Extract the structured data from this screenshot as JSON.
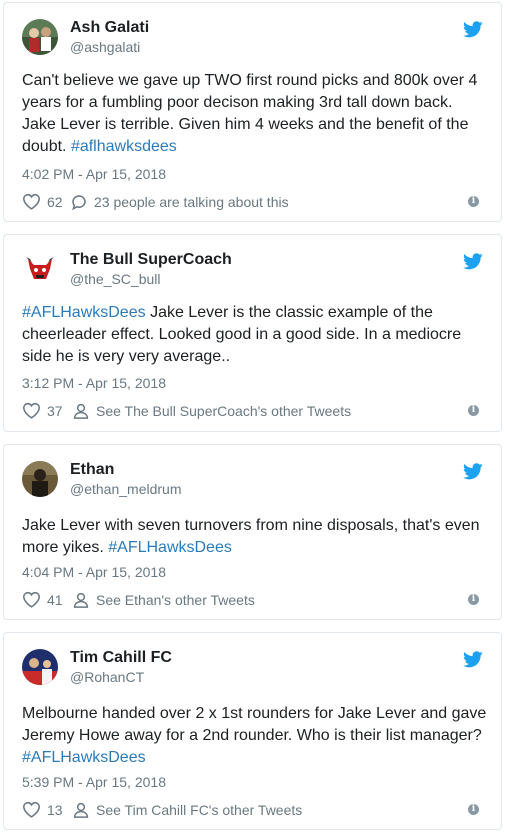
{
  "colors": {
    "link": "#2b7bb9",
    "muted": "#697882",
    "border": "#e1e8ed",
    "twitter_blue": "#1da1f2"
  },
  "tweets": [
    {
      "display_name": "Ash Galati",
      "handle": "@ashgalati",
      "text": "Can't believe we gave up TWO first round picks and 800k over 4 years for a fumbling poor decison making 3rd tall down back. Jake Lever is terrible. Given him 4 weeks and the benefit of the doubt.",
      "hashtag": "#aflhawksdees",
      "timestamp": "4:02 PM - Apr 15, 2018",
      "likes": "62",
      "extra_icon": "reply-bubble-icon",
      "extra_text": "23 people are talking about this"
    },
    {
      "display_name": "The Bull SuperCoach",
      "handle": "@the_SC_bull",
      "hashtag": "#AFLHawksDees",
      "text": "Jake Lever is the classic example of the cheerleader effect. Looked good in a good side. In a mediocre side he is very very average..",
      "timestamp": "3:12 PM - Apr 15, 2018",
      "likes": "37",
      "extra_icon": "person-icon",
      "extra_text": "See The Bull SuperCoach's other Tweets"
    },
    {
      "display_name": "Ethan",
      "handle": "@ethan_meldrum",
      "text": "Jake Lever with seven turnovers from nine disposals, that's even more yikes.",
      "hashtag": "#AFLHawksDees",
      "timestamp": "4:04 PM - Apr 15, 2018",
      "likes": "41",
      "extra_icon": "person-icon",
      "extra_text": "See Ethan's other Tweets"
    },
    {
      "display_name": "Tim Cahill FC",
      "handle": "@RohanCT",
      "text": "Melbourne handed over 2 x 1st rounders for Jake Lever and gave Jeremy Howe away for a 2nd rounder. Who is their list manager?",
      "hashtag": "#AFLHawksDees",
      "timestamp": "5:39 PM - Apr 15, 2018",
      "likes": "13",
      "extra_icon": "person-icon",
      "extra_text": "See Tim Cahill FC's other Tweets"
    }
  ]
}
